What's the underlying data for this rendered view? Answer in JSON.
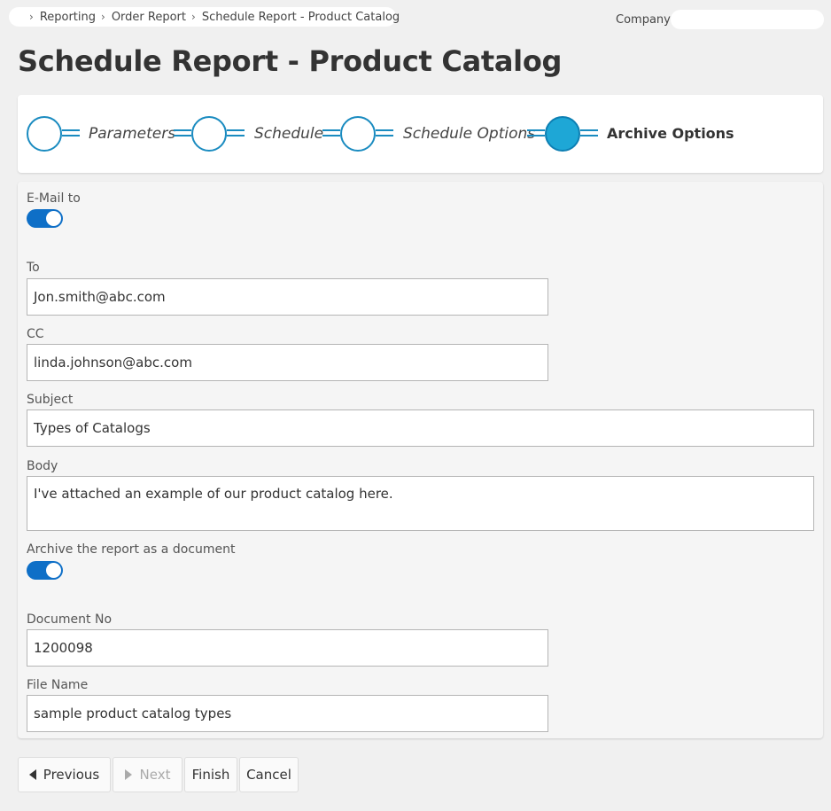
{
  "breadcrumb": {
    "items": [
      "Reporting",
      "Order Report",
      "Schedule Report - Product Catalog"
    ]
  },
  "company": {
    "label": "Company",
    "value": ""
  },
  "page": {
    "title": "Schedule Report - Product Catalog"
  },
  "wizard": {
    "steps": [
      {
        "label": "Parameters",
        "active": false
      },
      {
        "label": "Schedule",
        "active": false
      },
      {
        "label": "Schedule Options",
        "active": false
      },
      {
        "label": "Archive Options",
        "active": true
      }
    ]
  },
  "form": {
    "email_toggle": {
      "label": "E-Mail to",
      "on": true
    },
    "to": {
      "label": "To",
      "value": "Jon.smith@abc.com"
    },
    "cc": {
      "label": "CC",
      "value": "linda.johnson@abc.com"
    },
    "subject": {
      "label": "Subject",
      "value": "Types of Catalogs"
    },
    "body": {
      "label": "Body",
      "value": "I've attached an example of our product catalog here."
    },
    "archive_toggle": {
      "label": "Archive the report as a document",
      "on": true
    },
    "document_no": {
      "label": "Document No",
      "value": "1200098"
    },
    "file_name": {
      "label": "File Name",
      "value": "sample product catalog types"
    }
  },
  "buttons": {
    "previous": "Previous",
    "next": "Next",
    "finish": "Finish",
    "cancel": "Cancel"
  },
  "colors": {
    "accent": "#0e6fc7",
    "step_active": "#1ea7d6",
    "step_border": "#1a8bc0"
  }
}
